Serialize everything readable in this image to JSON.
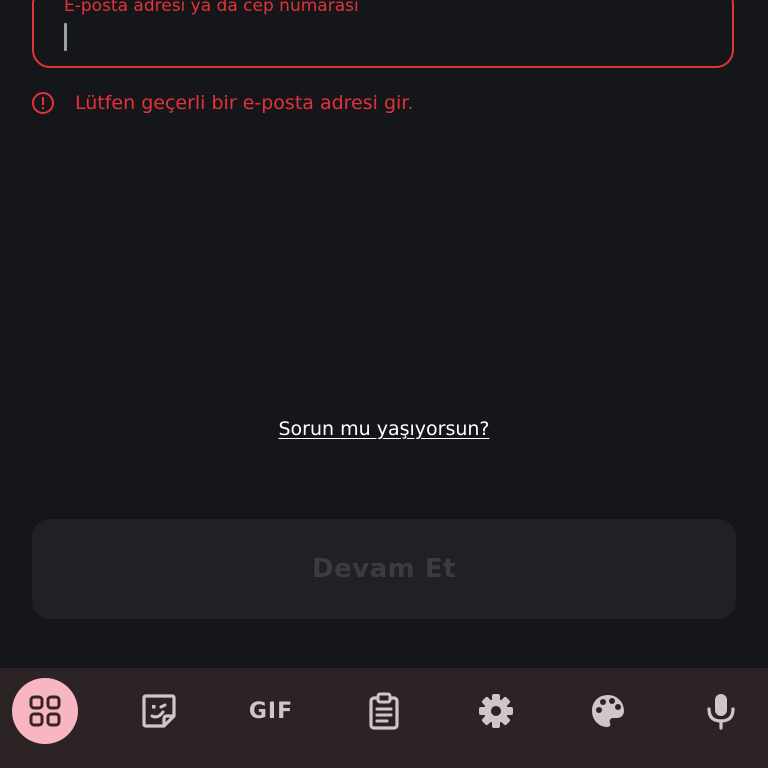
{
  "email_field": {
    "floating_label": "E-posta adresi ya da cep numarası",
    "value": ""
  },
  "error": {
    "icon": "error-icon",
    "message": "Lütfen geçerli bir e-posta adresi gir."
  },
  "help_link": "Sorun mu yaşıyorsun?",
  "continue_button": {
    "label": "Devam Et",
    "enabled": false
  },
  "keyboard_toolbar": {
    "items": [
      {
        "icon": "apps-grid-icon",
        "active": true
      },
      {
        "icon": "sticker-icon"
      },
      {
        "icon": "gif-icon",
        "label": "GIF"
      },
      {
        "icon": "clipboard-icon"
      },
      {
        "icon": "gear-icon"
      },
      {
        "icon": "palette-icon"
      },
      {
        "icon": "microphone-icon"
      }
    ]
  },
  "colors": {
    "background": "#15161a",
    "error": "#e5323a",
    "button_disabled": "#202124",
    "toolbar": "#2b2324",
    "active_tool": "#f7b6c1"
  }
}
